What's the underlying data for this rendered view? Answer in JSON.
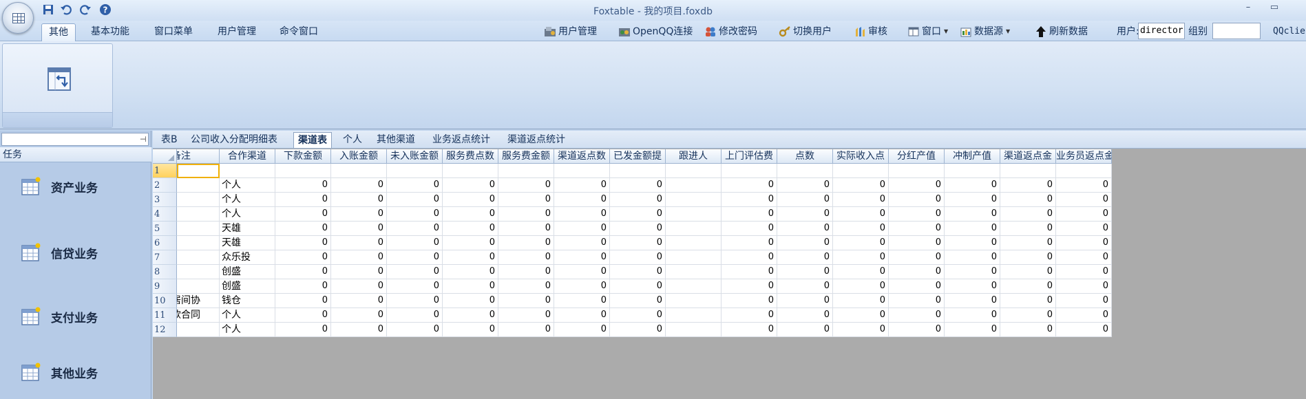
{
  "window": {
    "title": "Foxtable - 我的项目.foxdb",
    "minimize": "–",
    "restore": "▭",
    "close": ""
  },
  "ribbon_tabs": [
    {
      "label": "其他",
      "active": true
    },
    {
      "label": "基本功能"
    },
    {
      "label": "窗口菜单"
    },
    {
      "label": "用户管理"
    },
    {
      "label": "命令窗口"
    }
  ],
  "quick_buttons": {
    "user_manage": "用户管理",
    "openqq": "OpenQQ连接",
    "change_pwd": "修改密码",
    "switch_user": "切换用户",
    "audit": "审核",
    "window": "窗口",
    "datasource": "数据源",
    "refresh": "刷新数据",
    "user_label": "用户:",
    "user_value": "director",
    "group_label": "组别",
    "group_value": "",
    "qqclient": "QQclie"
  },
  "left_pane": {
    "search_value": "",
    "task_header": "任务",
    "tasks": [
      "资产业务",
      "信贷业务",
      "支付业务",
      "其他业务"
    ]
  },
  "sheet_tabs": [
    {
      "label": "表B"
    },
    {
      "label": "公司收入分配明细表"
    },
    {
      "label": "渠道表",
      "active": true
    },
    {
      "label": "个人"
    },
    {
      "label": "其他渠道"
    },
    {
      "label": "业务返点统计"
    },
    {
      "label": "渠道返点统计"
    }
  ],
  "table": {
    "columns": [
      "备注",
      "合作渠道",
      "下款金额",
      "入账金额",
      "未入账金额",
      "服务费点数",
      "服务费金额",
      "渠道返点数",
      "已发金额提",
      "跟进人",
      "上门评估费",
      "点数",
      "实际收入点",
      "分红产值",
      "冲制产值",
      "渠道返点金",
      "业务员返点金额"
    ],
    "rows": [
      {
        "n": "1",
        "note": "",
        "channel": "",
        "v": [
          "",
          "",
          "",
          "",
          "",
          "",
          "",
          "",
          "",
          "",
          "",
          "",
          "",
          "",
          "",
          ""
        ]
      },
      {
        "n": "2",
        "note": "",
        "channel": "个人",
        "v": [
          "0",
          "0",
          "0",
          "0",
          "0",
          "0",
          "0",
          "",
          "0",
          "0",
          "0",
          "0",
          "0",
          "0",
          "0"
        ]
      },
      {
        "n": "3",
        "note": "",
        "channel": "个人",
        "v": [
          "0",
          "0",
          "0",
          "0",
          "0",
          "0",
          "0",
          "",
          "0",
          "0",
          "0",
          "0",
          "0",
          "0",
          "0"
        ]
      },
      {
        "n": "4",
        "note": "",
        "channel": "个人",
        "v": [
          "0",
          "0",
          "0",
          "0",
          "0",
          "0",
          "0",
          "",
          "0",
          "0",
          "0",
          "0",
          "0",
          "0",
          "0"
        ]
      },
      {
        "n": "5",
        "note": "",
        "channel": "天雄",
        "v": [
          "0",
          "0",
          "0",
          "0",
          "0",
          "0",
          "0",
          "",
          "0",
          "0",
          "0",
          "0",
          "0",
          "0",
          "0"
        ]
      },
      {
        "n": "6",
        "note": "",
        "channel": "天雄",
        "v": [
          "0",
          "0",
          "0",
          "0",
          "0",
          "0",
          "0",
          "",
          "0",
          "0",
          "0",
          "0",
          "0",
          "0",
          "0"
        ]
      },
      {
        "n": "7",
        "note": "",
        "channel": "众乐投",
        "v": [
          "0",
          "0",
          "0",
          "0",
          "0",
          "0",
          "0",
          "",
          "0",
          "0",
          "0",
          "0",
          "0",
          "0",
          "0"
        ]
      },
      {
        "n": "8",
        "note": "",
        "channel": "创盛",
        "v": [
          "0",
          "0",
          "0",
          "0",
          "0",
          "0",
          "0",
          "",
          "0",
          "0",
          "0",
          "0",
          "0",
          "0",
          "0"
        ]
      },
      {
        "n": "9",
        "note": "",
        "channel": "创盛",
        "v": [
          "0",
          "0",
          "0",
          "0",
          "0",
          "0",
          "0",
          "",
          "0",
          "0",
          "0",
          "0",
          "0",
          "0",
          "0"
        ]
      },
      {
        "n": "10",
        "note": "居间协",
        "channel": "钱仓",
        "v": [
          "0",
          "0",
          "0",
          "0",
          "0",
          "0",
          "0",
          "",
          "0",
          "0",
          "0",
          "0",
          "0",
          "0",
          "0"
        ]
      },
      {
        "n": "11",
        "note": "款合同",
        "channel": "个人",
        "v": [
          "0",
          "0",
          "0",
          "0",
          "0",
          "0",
          "0",
          "",
          "0",
          "0",
          "0",
          "0",
          "0",
          "0",
          "0"
        ]
      },
      {
        "n": "12",
        "note": "",
        "channel": "个人",
        "v": [
          "0",
          "0",
          "0",
          "0",
          "0",
          "0",
          "0",
          "",
          "0",
          "0",
          "0",
          "0",
          "0",
          "0",
          "0"
        ]
      }
    ]
  }
}
